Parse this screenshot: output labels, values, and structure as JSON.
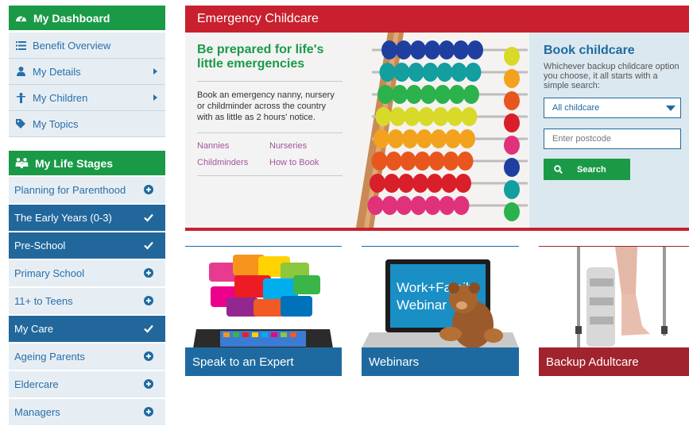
{
  "dashboard": {
    "title": "My Dashboard",
    "items": [
      {
        "label": "Benefit Overview",
        "icon": "list-icon"
      },
      {
        "label": "My Details",
        "icon": "user-icon"
      },
      {
        "label": "My Children",
        "icon": "child-icon"
      },
      {
        "label": "My Topics",
        "icon": "tag-icon"
      }
    ]
  },
  "life_stages": {
    "title": "My Life Stages",
    "items": [
      {
        "label": "Planning for Parenthood",
        "state": "add"
      },
      {
        "label": "The Early Years (0-3)",
        "state": "selected"
      },
      {
        "label": "Pre-School",
        "state": "selected"
      },
      {
        "label": "Primary School",
        "state": "add"
      },
      {
        "label": "11+ to Teens",
        "state": "add"
      },
      {
        "label": "My Care",
        "state": "selected"
      },
      {
        "label": "Ageing Parents",
        "state": "add"
      },
      {
        "label": "Eldercare",
        "state": "add"
      },
      {
        "label": "Managers",
        "state": "add"
      }
    ]
  },
  "hero": {
    "bar_title": "Emergency Childcare",
    "headline": "Be prepared for life's little emergencies",
    "description": "Book an emergency nanny, nursery or childminder across the country with as little as 2 hours' notice.",
    "links": [
      "Nannies",
      "Nurseries",
      "Childminders",
      "How to Book"
    ]
  },
  "booking": {
    "title": "Book childcare",
    "description": "Whichever backup childcare option you choose, it all starts with a simple search:",
    "select_value": "All childcare",
    "postcode_placeholder": "Enter postcode",
    "search_label": "Search"
  },
  "tiles": [
    {
      "label": "Speak to an Expert",
      "color": "#1e6aa0"
    },
    {
      "label": "Webinars",
      "color": "#1e6aa0"
    },
    {
      "label": "Backup Adultcare",
      "color": "#a0232e"
    }
  ],
  "tile_art": {
    "webinar_screen_text_1": "Work+Family",
    "webinar_screen_text_2": "Webinar"
  },
  "colors": {
    "green": "#1a9a47",
    "blue": "#1e6aa0",
    "red": "#c8202e",
    "link_purple": "#a3559a"
  }
}
